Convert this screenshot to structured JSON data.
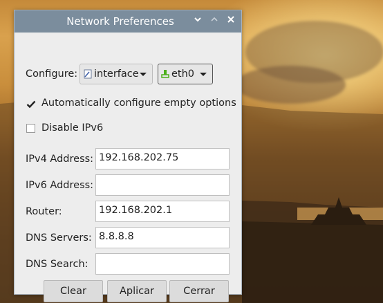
{
  "window": {
    "title": "Network Preferences"
  },
  "configure": {
    "label": "Configure:",
    "type_selected": "interface",
    "device_selected": "eth0"
  },
  "options": {
    "auto_configure": {
      "label": "Automatically configure empty options",
      "checked": true
    },
    "disable_ipv6": {
      "label": "Disable IPv6",
      "checked": false
    }
  },
  "fields": {
    "ipv4": {
      "label": "IPv4 Address:",
      "value": "192.168.202.75"
    },
    "ipv6": {
      "label": "IPv6 Address:",
      "value": ""
    },
    "router": {
      "label": "Router:",
      "value": "192.168.202.1"
    },
    "dns_servers": {
      "label": "DNS Servers:",
      "value": "8.8.8.8"
    },
    "dns_search": {
      "label": "DNS Search:",
      "value": ""
    }
  },
  "buttons": {
    "clear": "Clear",
    "apply": "Aplicar",
    "close": "Cerrar"
  },
  "colors": {
    "titlebar": "#7b8d9d",
    "window_bg": "#ededed",
    "device_icon": "#4caf1a"
  }
}
